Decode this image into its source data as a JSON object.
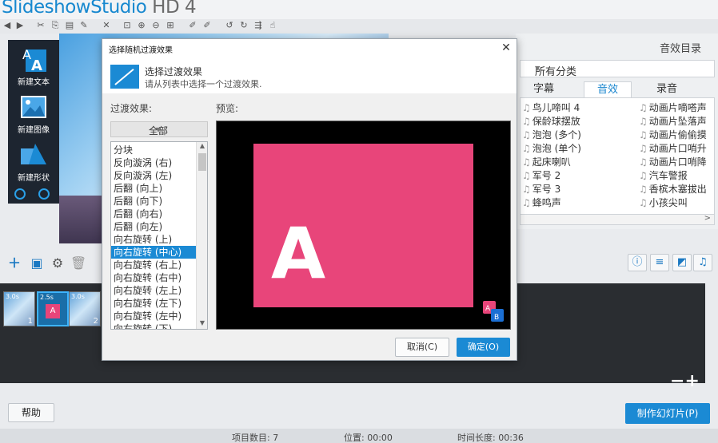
{
  "app": {
    "brand_name": "SlideshowStudio",
    "brand_version": "HD 4"
  },
  "left_panel": {
    "new_text": "新建文本",
    "new_image": "新建图像",
    "new_shape": "新建形状"
  },
  "audio_panel": {
    "title": "音效目录",
    "category_select": "所有分类",
    "tabs": [
      "字幕",
      "音效",
      "录音"
    ],
    "sounds_col1": [
      "鸟儿啼叫 4",
      "保龄球摆放",
      "泡泡 (多个)",
      "泡泡 (单个)",
      "起床喇叭",
      "军号 2",
      "军号 3",
      "蜂鸣声"
    ],
    "sounds_col2": [
      "动画片嘀嗒声",
      "动画片坠落声",
      "动画片偷偷摸",
      "动画片口哨升",
      "动画片口哨降",
      "汽车警报",
      "香槟木塞拔出",
      "小孩尖叫"
    ]
  },
  "timeline": {
    "clips": [
      {
        "duration": "3.0s",
        "index": "1"
      },
      {
        "duration": "2.5s",
        "index": "",
        "mini": "A"
      },
      {
        "duration": "3.0s",
        "index": "2"
      }
    ]
  },
  "bottom": {
    "help": "帮助",
    "make": "制作幻灯片(P)"
  },
  "status": {
    "items": "项目数目: 7",
    "position": "位置: 00:00",
    "duration": "时间长度: 00:36"
  },
  "dialog": {
    "title": "选择随机过渡效果",
    "header_title": "选择过渡效果",
    "header_desc": "请从列表中选择一个过渡效果.",
    "effects_label": "过渡效果:",
    "preview_label": "预览:",
    "filter": "全部",
    "effects": [
      "分块",
      "反向漩涡 (右)",
      "反向漩涡 (左)",
      "后翻 (向上)",
      "后翻 (向下)",
      "后翻 (向右)",
      "后翻 (向左)",
      "向右旋转 (上)",
      "向右旋转 (中心)",
      "向右旋转 (右上)",
      "向右旋转 (右中)",
      "向右旋转 (左上)",
      "向右旋转 (左下)",
      "向右旋转 (左中)",
      "向右旋转 (下)"
    ],
    "selected_effect": "向右旋转 (中心)",
    "preview_letter": "A",
    "logo_a": "A",
    "logo_b": "B",
    "cancel": "取消(C)",
    "ok": "确定(O)"
  }
}
